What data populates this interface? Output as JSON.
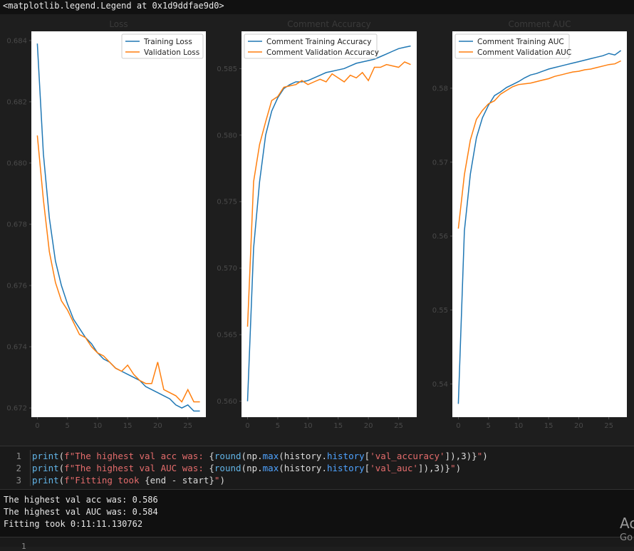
{
  "repr_text": "<matplotlib.legend.Legend at 0x1d9ddfae9d0>",
  "chart_data": [
    {
      "type": "line",
      "title": "Loss",
      "xlabel": "",
      "ylabel": "",
      "xlim": [
        -1,
        28
      ],
      "ylim": [
        0.6717,
        0.6843
      ],
      "xticks": [
        0,
        5,
        10,
        15,
        20,
        25
      ],
      "yticks": [
        0.672,
        0.674,
        0.676,
        0.678,
        0.68,
        0.682,
        0.684
      ],
      "ytick_labels": [
        "0.672",
        "0.674",
        "0.676",
        "0.678",
        "0.680",
        "0.682",
        "0.684"
      ],
      "legend": "top-right",
      "series": [
        {
          "name": "Training Loss",
          "color": "#1f77b4",
          "x": [
            0,
            1,
            2,
            3,
            4,
            5,
            6,
            7,
            8,
            9,
            10,
            11,
            12,
            13,
            14,
            15,
            16,
            17,
            18,
            19,
            20,
            21,
            22,
            23,
            24,
            25,
            26,
            27
          ],
          "values": [
            0.6839,
            0.6803,
            0.6782,
            0.6768,
            0.676,
            0.6754,
            0.6749,
            0.6746,
            0.6743,
            0.6741,
            0.6738,
            0.6736,
            0.6735,
            0.6733,
            0.6732,
            0.6731,
            0.673,
            0.6729,
            0.6727,
            0.6726,
            0.6725,
            0.6724,
            0.6723,
            0.6721,
            0.672,
            0.6721,
            0.6719,
            0.6719
          ]
        },
        {
          "name": "Validation Loss",
          "color": "#ff7f0e",
          "x": [
            0,
            1,
            2,
            3,
            4,
            5,
            6,
            7,
            8,
            9,
            10,
            11,
            12,
            13,
            14,
            15,
            16,
            17,
            18,
            19,
            20,
            21,
            22,
            23,
            24,
            25,
            26,
            27
          ],
          "values": [
            0.6809,
            0.6788,
            0.6771,
            0.6761,
            0.6755,
            0.6752,
            0.6748,
            0.6744,
            0.6743,
            0.674,
            0.6738,
            0.6737,
            0.6735,
            0.6733,
            0.6732,
            0.6734,
            0.6731,
            0.6729,
            0.6728,
            0.6728,
            0.6735,
            0.6726,
            0.6725,
            0.6724,
            0.6722,
            0.6726,
            0.6722,
            0.6722
          ]
        }
      ]
    },
    {
      "type": "line",
      "title": "Comment Accuracy",
      "xlabel": "",
      "ylabel": "",
      "xlim": [
        -1,
        28
      ],
      "ylim": [
        0.5588,
        0.5878
      ],
      "xticks": [
        0,
        5,
        10,
        15,
        20,
        25
      ],
      "yticks": [
        0.56,
        0.565,
        0.57,
        0.575,
        0.58,
        0.585
      ],
      "ytick_labels": [
        "0.560",
        "0.565",
        "0.570",
        "0.575",
        "0.580",
        "0.585"
      ],
      "legend": "top-left",
      "series": [
        {
          "name": "Comment Training Accuracy",
          "color": "#1f77b4",
          "x": [
            0,
            1,
            2,
            3,
            4,
            5,
            6,
            7,
            8,
            9,
            10,
            11,
            12,
            13,
            14,
            15,
            16,
            17,
            18,
            19,
            20,
            21,
            22,
            23,
            24,
            25,
            26,
            27
          ],
          "values": [
            0.56,
            0.5715,
            0.5765,
            0.58,
            0.5818,
            0.5828,
            0.5835,
            0.5838,
            0.584,
            0.584,
            0.5841,
            0.5843,
            0.5845,
            0.5847,
            0.5848,
            0.5849,
            0.585,
            0.5852,
            0.5854,
            0.5855,
            0.5856,
            0.5857,
            0.5859,
            0.5861,
            0.5863,
            0.5865,
            0.5866,
            0.5867
          ]
        },
        {
          "name": "Comment Validation Accuracy",
          "color": "#ff7f0e",
          "x": [
            0,
            1,
            2,
            3,
            4,
            5,
            6,
            7,
            8,
            9,
            10,
            11,
            12,
            13,
            14,
            15,
            16,
            17,
            18,
            19,
            20,
            21,
            22,
            23,
            24,
            25,
            26,
            27
          ],
          "values": [
            0.5656,
            0.5765,
            0.5793,
            0.581,
            0.5826,
            0.5829,
            0.5836,
            0.5837,
            0.5838,
            0.5841,
            0.5838,
            0.584,
            0.5842,
            0.584,
            0.5846,
            0.5843,
            0.584,
            0.5845,
            0.5843,
            0.5847,
            0.5841,
            0.5851,
            0.5851,
            0.5853,
            0.5852,
            0.5851,
            0.5855,
            0.5853
          ]
        }
      ]
    },
    {
      "type": "line",
      "title": "Comment AUC",
      "xlabel": "",
      "ylabel": "",
      "xlim": [
        -1,
        28
      ],
      "ylim": [
        0.5355,
        0.5877
      ],
      "xticks": [
        0,
        5,
        10,
        15,
        20,
        25
      ],
      "yticks": [
        0.54,
        0.55,
        0.56,
        0.57,
        0.58
      ],
      "ytick_labels": [
        "0.54",
        "0.55",
        "0.56",
        "0.57",
        "0.58"
      ],
      "legend": "top-left",
      "series": [
        {
          "name": "Comment Training AUC",
          "color": "#1f77b4",
          "x": [
            0,
            1,
            2,
            3,
            4,
            5,
            6,
            7,
            8,
            9,
            10,
            11,
            12,
            13,
            14,
            15,
            16,
            17,
            18,
            19,
            20,
            21,
            22,
            23,
            24,
            25,
            26,
            27
          ],
          "values": [
            0.5373,
            0.5607,
            0.5684,
            0.5733,
            0.576,
            0.5777,
            0.579,
            0.5795,
            0.5801,
            0.5805,
            0.5809,
            0.5814,
            0.5818,
            0.582,
            0.5823,
            0.5826,
            0.5828,
            0.583,
            0.5832,
            0.5834,
            0.5836,
            0.5838,
            0.584,
            0.5842,
            0.5844,
            0.5847,
            0.5845,
            0.5851
          ]
        },
        {
          "name": "Comment Validation AUC",
          "color": "#ff7f0e",
          "x": [
            0,
            1,
            2,
            3,
            4,
            5,
            6,
            7,
            8,
            9,
            10,
            11,
            12,
            13,
            14,
            15,
            16,
            17,
            18,
            19,
            20,
            21,
            22,
            23,
            24,
            25,
            26,
            27
          ],
          "values": [
            0.561,
            0.5683,
            0.573,
            0.5758,
            0.577,
            0.5779,
            0.5783,
            0.5792,
            0.5797,
            0.5802,
            0.5805,
            0.5806,
            0.5807,
            0.5809,
            0.5811,
            0.5813,
            0.5816,
            0.5818,
            0.582,
            0.5822,
            0.5823,
            0.5825,
            0.5826,
            0.5828,
            0.583,
            0.5832,
            0.5833,
            0.5837
          ]
        }
      ]
    }
  ],
  "code_cell": {
    "lines": [
      {
        "num": "1",
        "parts": [
          {
            "t": "print",
            "c": "kw"
          },
          {
            "t": "(",
            "c": "punc"
          },
          {
            "t": "f\"The highest val acc was: ",
            "c": "str"
          },
          {
            "t": "{",
            "c": "punc"
          },
          {
            "t": "round",
            "c": "kw"
          },
          {
            "t": "(np.",
            "c": "var"
          },
          {
            "t": "max",
            "c": "attr"
          },
          {
            "t": "(history.",
            "c": "var"
          },
          {
            "t": "history",
            "c": "attr"
          },
          {
            "t": "[",
            "c": "punc"
          },
          {
            "t": "'val_accuracy'",
            "c": "str"
          },
          {
            "t": "]),3)}",
            "c": "punc"
          },
          {
            "t": "\"",
            "c": "str"
          },
          {
            "t": ")",
            "c": "punc"
          }
        ]
      },
      {
        "num": "2",
        "parts": [
          {
            "t": "print",
            "c": "kw"
          },
          {
            "t": "(",
            "c": "punc"
          },
          {
            "t": "f\"The highest val AUC was: ",
            "c": "str"
          },
          {
            "t": "{",
            "c": "punc"
          },
          {
            "t": "round",
            "c": "kw"
          },
          {
            "t": "(np.",
            "c": "var"
          },
          {
            "t": "max",
            "c": "attr"
          },
          {
            "t": "(history.",
            "c": "var"
          },
          {
            "t": "history",
            "c": "attr"
          },
          {
            "t": "[",
            "c": "punc"
          },
          {
            "t": "'val_auc'",
            "c": "str"
          },
          {
            "t": "]),3)}",
            "c": "punc"
          },
          {
            "t": "\"",
            "c": "str"
          },
          {
            "t": ")",
            "c": "punc"
          }
        ]
      },
      {
        "num": "3",
        "parts": [
          {
            "t": "print",
            "c": "kw"
          },
          {
            "t": "(",
            "c": "punc"
          },
          {
            "t": "f\"Fitting took ",
            "c": "str"
          },
          {
            "t": "{end - start}",
            "c": "var"
          },
          {
            "t": "\"",
            "c": "str"
          },
          {
            "t": ")",
            "c": "punc"
          }
        ]
      }
    ]
  },
  "output": {
    "lines": [
      "The highest val acc was: 0.586",
      "The highest val AUC was: 0.584",
      "Fitting took 0:11:11.130762"
    ]
  },
  "next_cell_line_number": "1",
  "watermark": {
    "line1": "Ac",
    "line2": "Go"
  },
  "colors": {
    "training": "#1f77b4",
    "validation": "#ff7f0e"
  }
}
